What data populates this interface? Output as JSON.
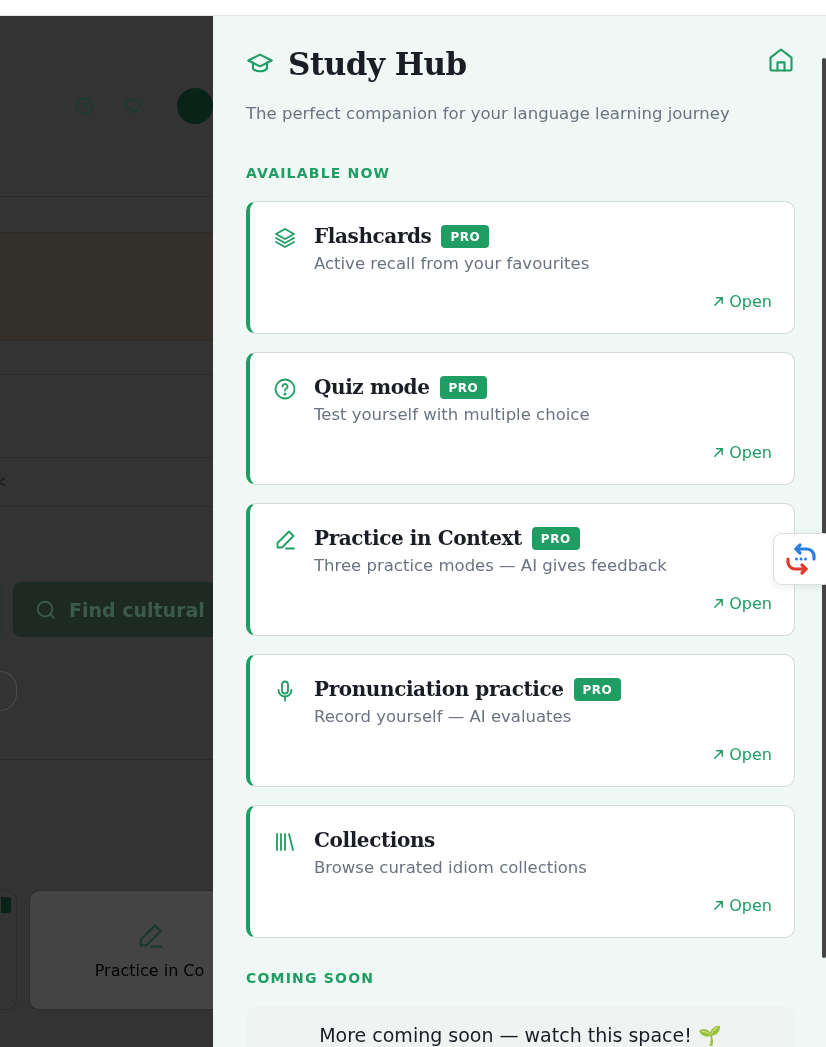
{
  "background_page": {
    "search_button": "Find cultural",
    "tool_card": "Practice in Co"
  },
  "drawer": {
    "title": "Study Hub",
    "subtitle": "The perfect companion for your language learning journey",
    "available_label": "AVAILABLE NOW",
    "tools": [
      {
        "title": "Flashcards",
        "pro": true,
        "badge": "PRO",
        "description": "Active recall from your favourites",
        "link": "Open"
      },
      {
        "title": "Quiz mode",
        "pro": true,
        "badge": "PRO",
        "description": "Test yourself with multiple choice",
        "link": "Open"
      },
      {
        "title": "Practice in Context",
        "pro": true,
        "badge": "PRO",
        "description": "Three practice modes — AI gives feedback",
        "link": "Open"
      },
      {
        "title": "Pronunciation practice",
        "pro": true,
        "badge": "PRO",
        "description": "Record yourself — AI evaluates",
        "link": "Open"
      },
      {
        "title": "Collections",
        "pro": false,
        "description": "Browse curated idiom collections",
        "link": "Open"
      }
    ],
    "coming_label": "COMING SOON",
    "coming_text": "More coming soon — watch this space! 🌱"
  }
}
